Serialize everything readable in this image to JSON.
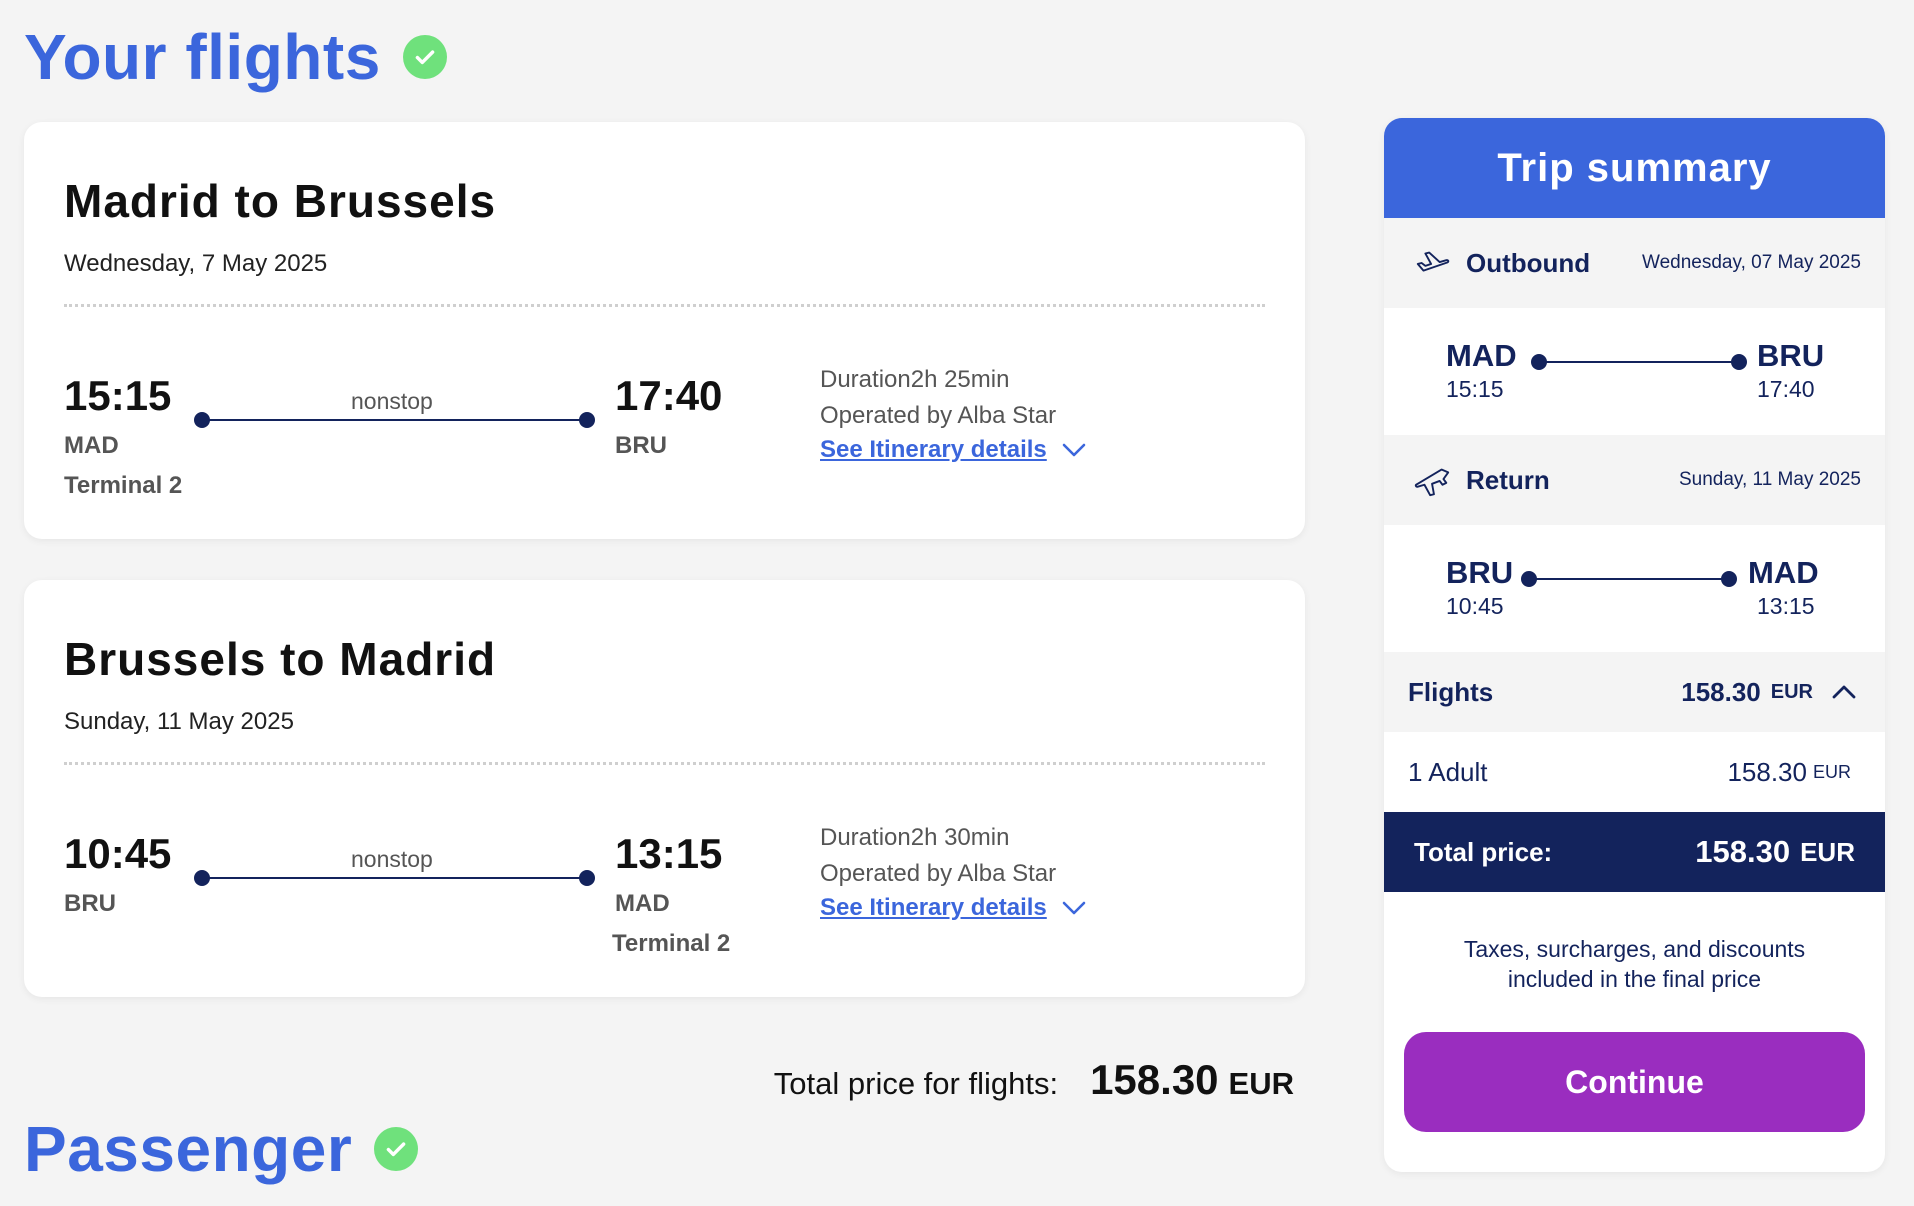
{
  "sections": {
    "flights_title": "Your flights",
    "passenger_title": "Passenger"
  },
  "flights": [
    {
      "title": "Madrid to Brussels",
      "date": "Wednesday, 7 May 2025",
      "dep_time": "15:15",
      "dep_code": "MAD",
      "dep_terminal": "Terminal 2",
      "stops": "nonstop",
      "arr_time": "17:40",
      "arr_code": "BRU",
      "arr_terminal": "",
      "duration": "Duration2h 25min",
      "operated": "Operated by  Alba Star",
      "itinerary_link": "See Itinerary details"
    },
    {
      "title": "Brussels to Madrid",
      "date": "Sunday, 11 May 2025",
      "dep_time": "10:45",
      "dep_code": "BRU",
      "dep_terminal": "",
      "stops": "nonstop",
      "arr_time": "13:15",
      "arr_code": "MAD",
      "arr_terminal": "Terminal 2",
      "duration": "Duration2h 30min",
      "operated": "Operated by  Alba Star",
      "itinerary_link": "See Itinerary details"
    }
  ],
  "total_flights": {
    "label": "Total price for flights:",
    "value": "158.30",
    "currency": "EUR"
  },
  "summary": {
    "title": "Trip summary",
    "outbound": {
      "label": "Outbound",
      "date": "Wednesday, 07 May 2025",
      "from_code": "MAD",
      "from_time": "15:15",
      "to_code": "BRU",
      "to_time": "17:40"
    },
    "return": {
      "label": "Return",
      "date": "Sunday, 11 May 2025",
      "from_code": "BRU",
      "from_time": "10:45",
      "to_code": "MAD",
      "to_time": "13:15"
    },
    "flights_label": "Flights",
    "flights_amount": "158.30",
    "flights_currency": "EUR",
    "adult_label": "1 Adult",
    "adult_amount": "158.30",
    "adult_currency": "EUR",
    "total_label": "Total price:",
    "total_amount": "158.30",
    "total_currency": "EUR",
    "taxes_note": "Taxes, surcharges, and discounts included in the final price",
    "continue_label": "Continue"
  },
  "colors": {
    "accent_blue": "#3b66dc",
    "navy": "#13235c",
    "check_green": "#6fe17c",
    "continue_purple": "#9a2dbf"
  },
  "icons": [
    "check-circle-icon",
    "plane-depart-icon",
    "plane-return-icon",
    "chevron-down-icon",
    "chevron-up-icon"
  ]
}
